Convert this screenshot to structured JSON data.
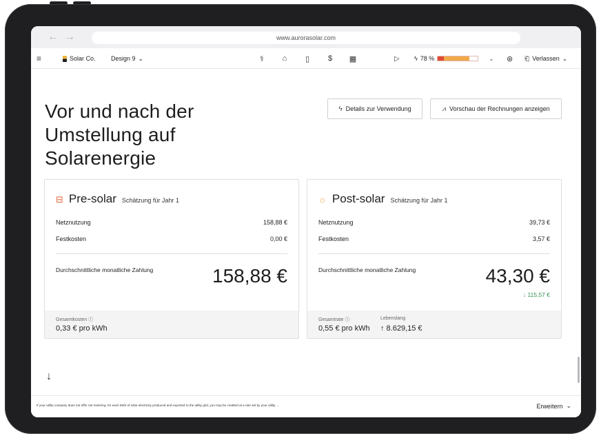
{
  "browser": {
    "back": "←",
    "forward": "→",
    "url": "www.aurorasolar.com"
  },
  "header": {
    "menu_icon": "≡",
    "logo_text": "Solar Co.",
    "design_label": "Design 9",
    "chevron": "⌄",
    "toolbar_icons": [
      {
        "name": "stethoscope-icon",
        "glyph": "⚕"
      },
      {
        "name": "home-icon",
        "glyph": "⌂"
      },
      {
        "name": "battery-icon",
        "glyph": "▯"
      },
      {
        "name": "dollar-circle-icon",
        "glyph": "$"
      },
      {
        "name": "solar-panel-icon",
        "glyph": "▦"
      }
    ],
    "play_icon": "▷",
    "bolt_icon": "ϟ",
    "usage_percent_text": "78 %",
    "usage_fraction": 0.78,
    "help_icon": "⊛",
    "exit_icon": "⎗",
    "exit_label": "Verlassen"
  },
  "page": {
    "title": "Vor und nach der Umstellung auf Solarenergie",
    "details_button": "Details zur Verwendung",
    "preview_button": "Vorschau der Rechnungen anzeigen",
    "down_arrow": "↓"
  },
  "pre_solar": {
    "icon": "⊟",
    "title": "Pre-solar",
    "subtitle": "Schätzung für Jahr 1",
    "grid_label": "Netznutzung",
    "grid_value": "158,88 €",
    "fixed_label": "Festkosten",
    "fixed_value": "0,00 €",
    "avg_label": "Durchschnittliche monatliche Zahlung",
    "avg_value": "158,88 €",
    "footer_label": "Gesamtkosten",
    "footer_value": "0,33 € pro kWh"
  },
  "post_solar": {
    "icon": "☼",
    "title": "Post-solar",
    "subtitle": "Schätzung für Jahr 1",
    "grid_label": "Netznutzung",
    "grid_value": "39,73 €",
    "fixed_label": "Festkosten",
    "fixed_value": "3,57 €",
    "avg_label": "Durchschnittliche monatliche Zahlung",
    "avg_value": "43,30 €",
    "saving": "↓ 115,57 €",
    "footer_label": "Gesamtrate",
    "footer_value": "0,55 € pro kWh",
    "lifetime_label": "Lebenslang",
    "lifetime_value": "↑ 8.629,15 €"
  },
  "footer": {
    "note": "If your utility company does not offer net metering, for each kWh of solar electricity produced and exported to the utility grid, you may be credited at a rate set by your utility ...",
    "expand_label": "Erweitern"
  },
  "colors": {
    "accent_orange": "#f0a94a",
    "accent_red": "#e04a3a",
    "saving_green": "#2f8f4f"
  }
}
